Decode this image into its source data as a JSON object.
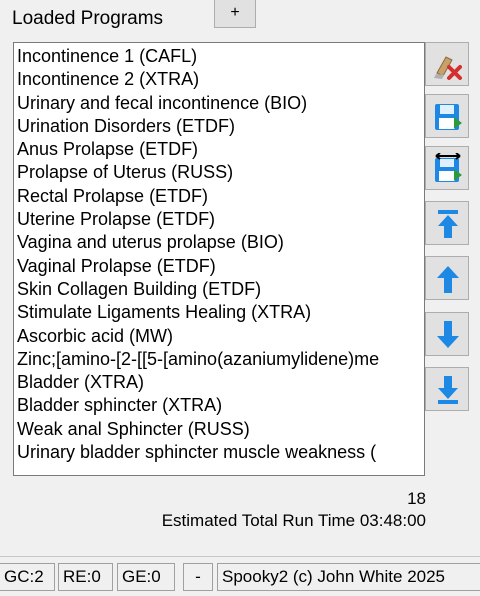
{
  "header": {
    "title": "Loaded Programs",
    "add_label": "+"
  },
  "programs": [
    "Incontinence 1 (CAFL)",
    "Incontinence 2 (XTRA)",
    "Urinary and fecal incontinence (BIO)",
    "Urination Disorders (ETDF)",
    "Anus Prolapse (ETDF)",
    "Prolapse of Uterus (RUSS)",
    "Rectal Prolapse (ETDF)",
    "Uterine Prolapse (ETDF)",
    "Vagina and uterus prolapse (BIO)",
    "Vaginal Prolapse (ETDF)",
    "Skin  Collagen Building (ETDF)",
    "Stimulate Ligaments Healing (XTRA)",
    "Ascorbic acid (MW)",
    "Zinc;[amino-[2-[[5-[amino(azaniumylidene)me",
    "Bladder (XTRA)",
    "Bladder sphincter (XTRA)",
    "Weak anal Sphincter (RUSS)",
    "Urinary bladder sphincter muscle weakness ("
  ],
  "side_buttons": [
    {
      "name": "clear-button",
      "icon": "broom-delete-icon"
    },
    {
      "name": "save-button",
      "icon": "save-icon"
    },
    {
      "name": "save-as-button",
      "icon": "save-arrows-icon"
    },
    {
      "name": "move-top-button",
      "icon": "arrow-to-top-icon"
    },
    {
      "name": "move-up-button",
      "icon": "arrow-up-icon"
    },
    {
      "name": "move-down-button",
      "icon": "arrow-down-icon"
    },
    {
      "name": "move-bottom-button",
      "icon": "arrow-to-bottom-icon"
    }
  ],
  "summary": {
    "count": "18",
    "runtime": "Estimated Total Run Time 03:48:00"
  },
  "status": {
    "gc": "GC:2",
    "re": "RE:0",
    "ge": "GE:0",
    "dash": "-",
    "copyright": "Spooky2 (c) John White 2025"
  },
  "colors": {
    "accent": "#1e88e5",
    "save_green": "#2e9b3a",
    "delete_red": "#d32f2f"
  }
}
